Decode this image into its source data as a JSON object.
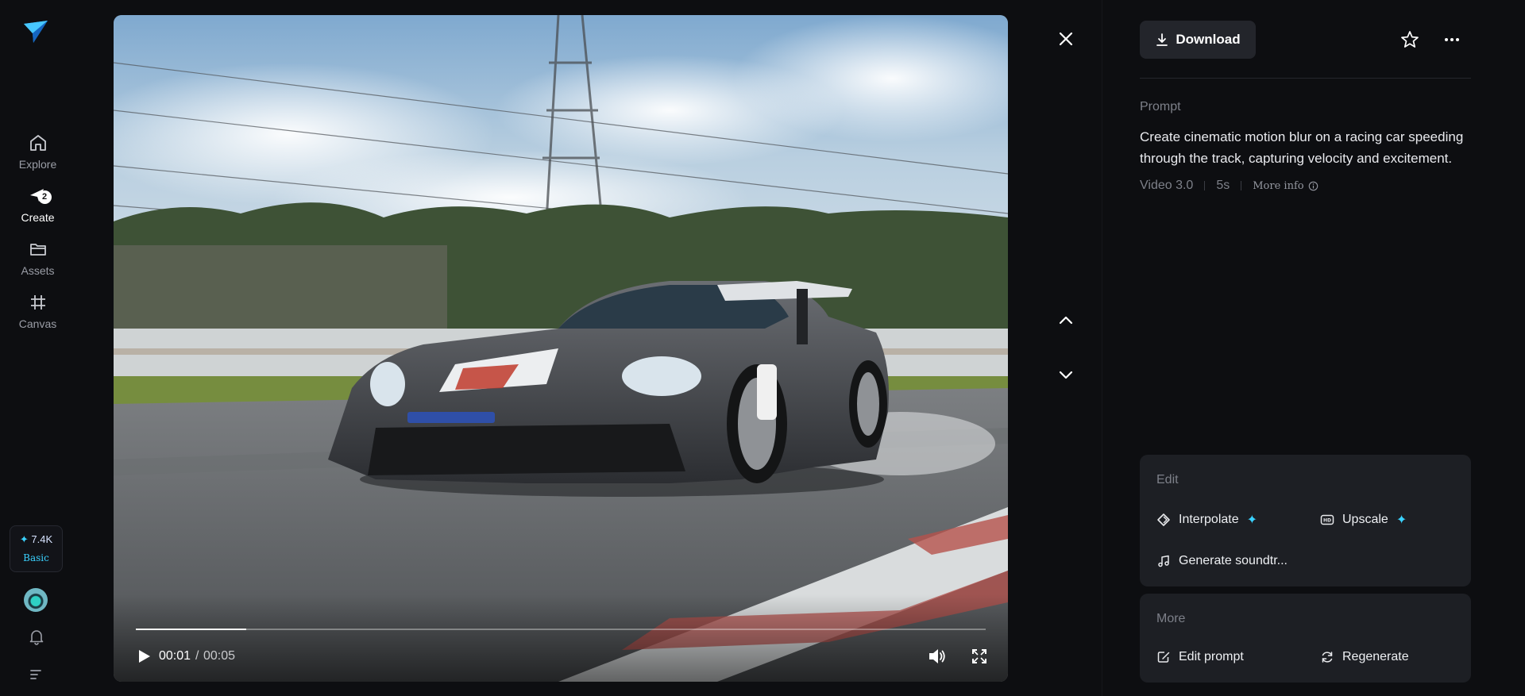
{
  "sidebar": {
    "items": [
      {
        "label": "Explore"
      },
      {
        "label": "Create",
        "badge": "2"
      },
      {
        "label": "Assets"
      },
      {
        "label": "Canvas"
      }
    ],
    "credits": {
      "amount": "7.4K",
      "plan": "Basic"
    }
  },
  "player": {
    "current_time": "00:01",
    "separator": "/",
    "total_time": "00:05",
    "progress": 0.13
  },
  "panel": {
    "download_label": "Download",
    "prompt_label": "Prompt",
    "prompt_text": "Create cinematic motion blur on a racing car speeding through the track, capturing velocity and excitement.",
    "model": "Video 3.0",
    "duration": "5s",
    "more_info": "More info",
    "edit": {
      "title": "Edit",
      "actions": [
        {
          "label": "Interpolate",
          "premium": true
        },
        {
          "label": "Upscale",
          "premium": true
        },
        {
          "label": "Generate soundtr...",
          "premium": false
        }
      ]
    },
    "more": {
      "title": "More",
      "actions": [
        {
          "label": "Edit prompt"
        },
        {
          "label": "Regenerate"
        }
      ]
    }
  },
  "colors": {
    "accent": "#3ad2ff",
    "background": "#0d0e11",
    "card": "#1d1f24"
  }
}
